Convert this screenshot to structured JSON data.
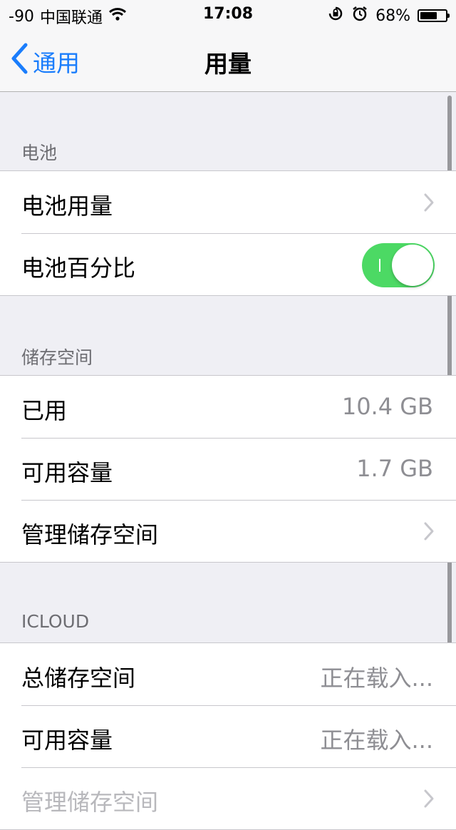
{
  "status_bar": {
    "signal": "-90",
    "carrier": "中国联通",
    "time": "17:08",
    "battery_percent": "68%",
    "battery_level": 0.68,
    "icons": [
      "wifi-icon",
      "rotation-lock-icon",
      "alarm-icon",
      "battery-icon"
    ]
  },
  "nav": {
    "back_label": "通用",
    "title": "用量",
    "accent_color": "#1a7dfc"
  },
  "sections": {
    "battery": {
      "header": "电池",
      "usage_label": "电池用量",
      "percentage_label": "电池百分比",
      "percentage_on": true,
      "toggle_color": "#4cd964"
    },
    "storage": {
      "header": "储存空间",
      "used_label": "已用",
      "used_value": "10.4 GB",
      "available_label": "可用容量",
      "available_value": "1.7 GB",
      "manage_label": "管理储存空间"
    },
    "icloud": {
      "header": "ICLOUD",
      "total_label": "总储存空间",
      "total_value": "正在载入...",
      "available_label": "可用容量",
      "available_value": "正在载入...",
      "manage_label": "管理储存空间"
    }
  }
}
